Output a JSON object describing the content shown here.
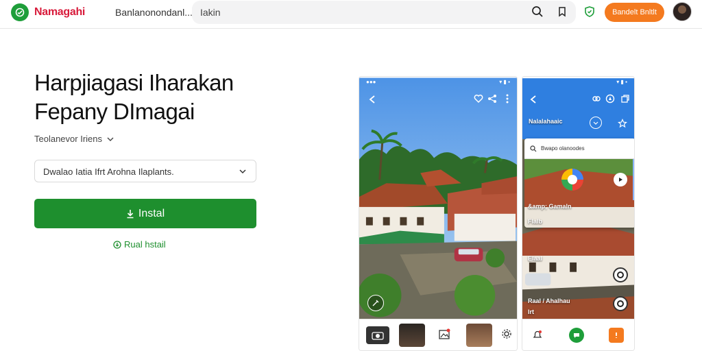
{
  "header": {
    "brand": "Namagahi",
    "nav_link": "Banlanonondanl...",
    "search_value": "Iakin",
    "cta_label": "Bandelt Bnltlt"
  },
  "hero": {
    "title_line1": "Harpjiagasi Iharakan",
    "title_line2": "Fepany DImagai",
    "subtitle": "Teolanevor Iriens",
    "select_value": "Dwalao Iatia Ifrt Arohna Ilaplants.",
    "install_label": "Instal",
    "alt_link": "Rual hstail"
  },
  "phone2": {
    "header_title": "Nalalahaaic",
    "search_text": "Bwapo olanoodes",
    "label_1": "&amp; Gamaln",
    "label_2": "Flalb",
    "label_3": "Elaal",
    "label_4": "Raal / Ahalhau",
    "label_5": "Irt"
  },
  "colors": {
    "brand_red": "#d81b3b",
    "primary_green": "#1e8f2e",
    "cta_orange": "#f47a1f",
    "app_blue": "#2f7fe0"
  }
}
